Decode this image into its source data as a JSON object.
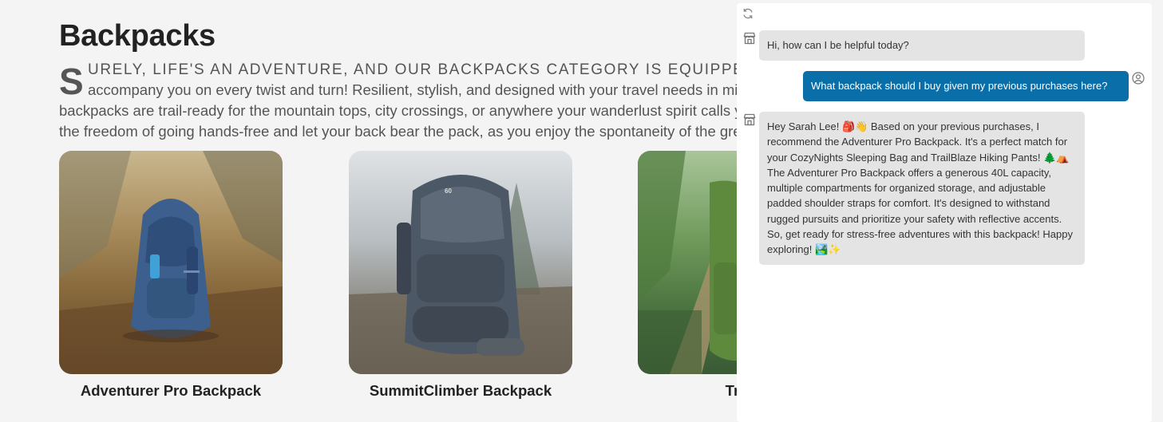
{
  "page": {
    "title": "Backpacks",
    "intro": {
      "dropcap": "S",
      "line1": "URELY, LIFE'S AN ADVENTURE, AND OUR BACKPACKS CATEGORY IS EQUIPPED T",
      "line2": "accompany you on every twist and turn! Resilient, stylish, and designed with your travel needs in min",
      "line3": "backpacks are trail-ready for the mountain tops, city crossings, or anywhere your wanderlust spirit calls y",
      "line4": "the freedom of going hands-free and let your back bear the pack, as you enjoy the spontaneity of the gre"
    },
    "products": [
      {
        "name": "Adventurer Pro Backpack"
      },
      {
        "name": "SummitClimber Backpack"
      },
      {
        "name": "TrailLit"
      }
    ]
  },
  "chat": {
    "messages": [
      {
        "role": "bot",
        "text": "Hi, how can I be helpful today?"
      },
      {
        "role": "user",
        "text": "What backpack should I buy given my previous purchases here?"
      },
      {
        "role": "bot",
        "lines": [
          "Hey Sarah Lee! 🎒👋 Based on your previous purchases, I",
          "recommend the Adventurer Pro Backpack. It's a perfect match for",
          "your CozyNights Sleeping Bag and TrailBlaze Hiking Pants! 🌲⛺",
          "The Adventurer Pro Backpack offers a generous 40L capacity,",
          "multiple compartments for organized storage, and adjustable",
          "padded shoulder straps for comfort. It's designed to withstand",
          "rugged pursuits and prioritize your safety with reflective accents.",
          "So, get ready for stress-free adventures with this backpack! Happy",
          "exploring! 🏞️✨"
        ]
      }
    ],
    "icons": {
      "refresh": "refresh-icon",
      "bot_avatar": "store-icon",
      "user_avatar": "user-circle-icon"
    },
    "colors": {
      "user_bubble": "#0a6ea9",
      "bot_bubble": "#e4e4e4"
    }
  }
}
